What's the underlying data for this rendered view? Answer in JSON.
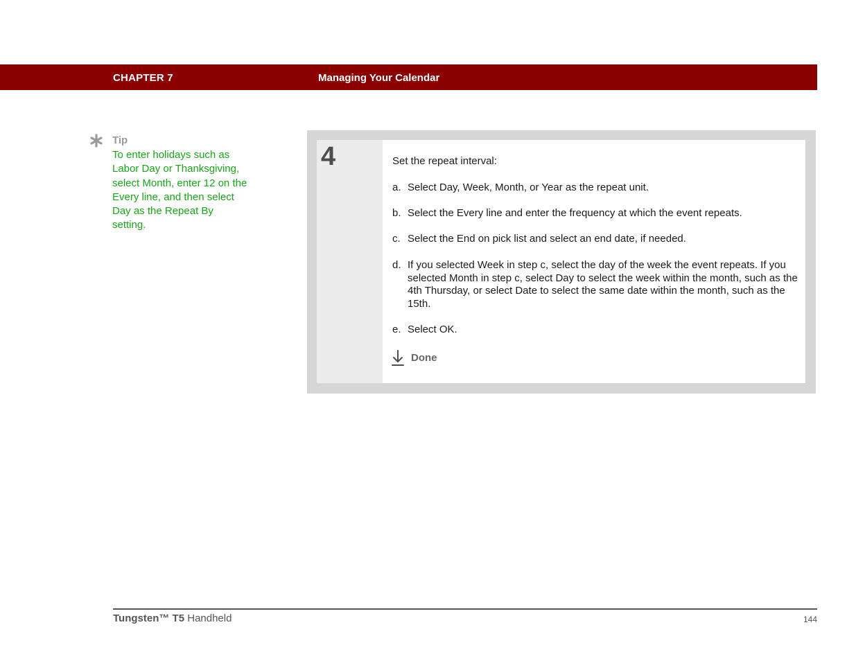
{
  "header": {
    "chapter": "CHAPTER 7",
    "title": "Managing Your Calendar",
    "bar_color": "#8b0000"
  },
  "tip": {
    "icon": "asterisk-icon",
    "heading": "Tip",
    "body": "To enter holidays such as Labor Day or Thanksgiving, select Month, enter 12 on the Every line, and then select Day as the Repeat By setting.",
    "text_color": "#1aa31a"
  },
  "step": {
    "number": "4",
    "intro": "Set the repeat interval:",
    "substeps": [
      {
        "letter": "a.",
        "text": "Select Day, Week, Month, or Year as the repeat unit."
      },
      {
        "letter": "b.",
        "text": "Select the Every line and enter the frequency at which the event repeats."
      },
      {
        "letter": "c.",
        "text": "Select the End on pick list and select an end date, if needed."
      },
      {
        "letter": "d.",
        "text": "If you selected Week in step c, select the day of the week the event repeats. If you selected Month in step c, select Day to select the week within the month, such as the 4th Thursday, or select Date to select the same date within the month, such as the 15th."
      },
      {
        "letter": "e.",
        "text": "Select OK."
      }
    ],
    "done_icon": "done-arrow-icon",
    "done_label": "Done"
  },
  "footer": {
    "product_brand": "Tungsten™ T5",
    "product_suffix": " Handheld",
    "page": "144"
  }
}
